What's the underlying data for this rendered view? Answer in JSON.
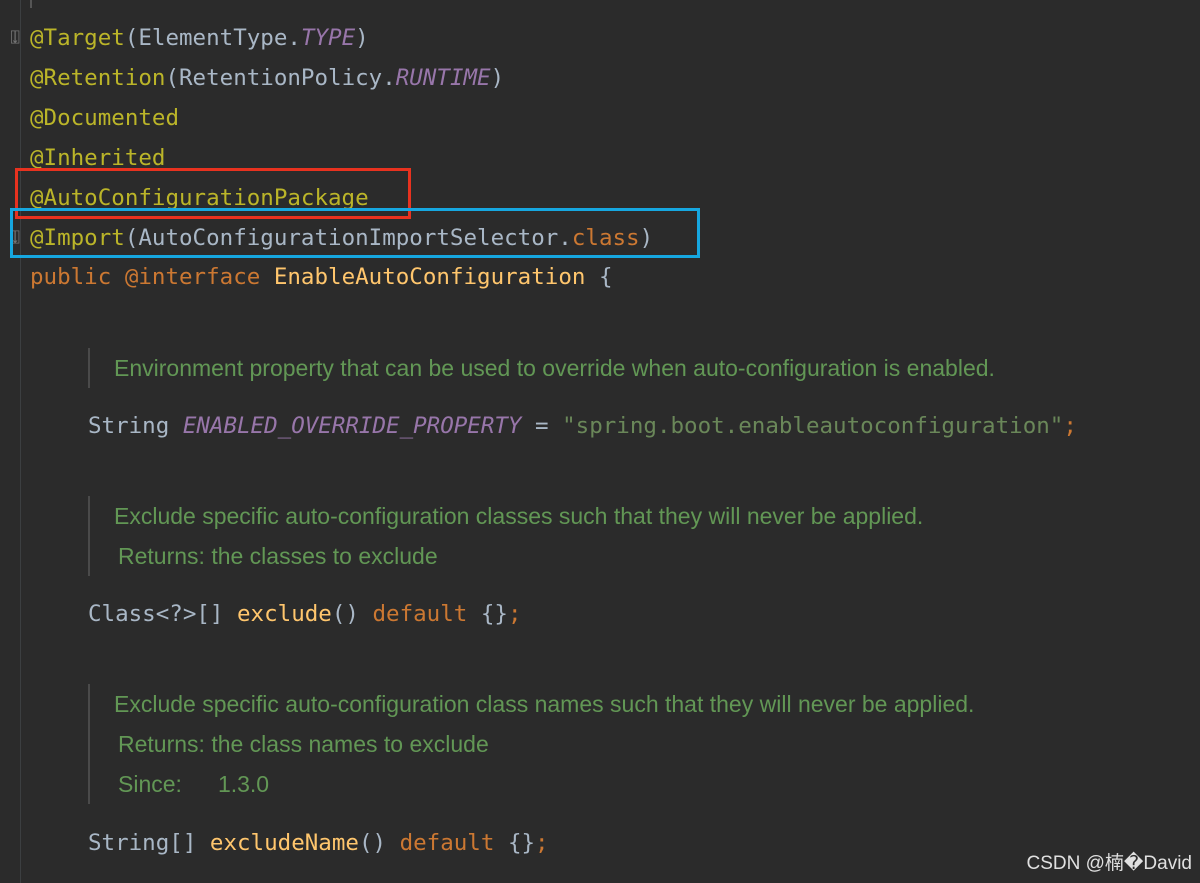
{
  "editor": {
    "lines": [
      {
        "parts": [
          "@Target",
          "(ElementType.",
          "TYPE",
          ")"
        ]
      },
      {
        "parts": [
          "@Retention",
          "(RetentionPolicy.",
          "RUNTIME",
          ")"
        ]
      },
      {
        "parts": [
          "@Documented"
        ]
      },
      {
        "parts": [
          "@Inherited"
        ]
      },
      {
        "parts": [
          "@AutoConfigurationPackage"
        ]
      },
      {
        "parts": [
          "@Import",
          "(AutoConfigurationImportSelector.",
          "class",
          ")"
        ]
      },
      {
        "parts": [
          "public ",
          "@interface ",
          "EnableAutoConfiguration",
          " {"
        ]
      }
    ],
    "doc1": "Environment property that can be used to override when auto-configuration is enabled.",
    "field1": {
      "type": "String ",
      "name": "ENABLED_OVERRIDE_PROPERTY",
      "eq": " = ",
      "value": "\"spring.boot.enableautoconfiguration\"",
      "semi": ";"
    },
    "doc2": {
      "text": "Exclude specific auto-configuration classes such that they will never be applied.",
      "returns": "Returns: the classes to exclude"
    },
    "method1": {
      "type": "Class<?>[] ",
      "name": "exclude",
      "paren": "() ",
      "kw": "default",
      "rest": " {}",
      "semi": ";"
    },
    "doc3": {
      "text": "Exclude specific auto-configuration class names such that they will never be applied.",
      "returns": "Returns: the class names to exclude",
      "since_label": "Since:",
      "since_value": "1.3.0"
    },
    "method2": {
      "type": "String[] ",
      "name": "excludeName",
      "paren": "() ",
      "kw": "default",
      "rest": " {}",
      "semi": ";"
    }
  },
  "watermark": "CSDN @楠�David",
  "colors": {
    "highlight_red": "#e8321f",
    "highlight_blue": "#16a7e0",
    "background": "#2b2b2b"
  }
}
